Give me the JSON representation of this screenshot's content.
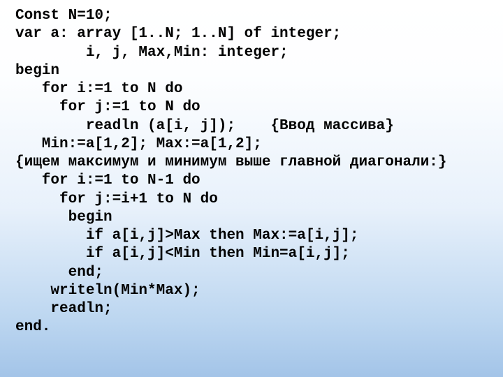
{
  "code": {
    "l01": "Const N=10;",
    "l02": "var a: array [1..N; 1..N] of integer;",
    "l03": "        i, j, Max,Min: integer;",
    "l04": "begin",
    "l05": "   for i:=1 to N do",
    "l06": "     for j:=1 to N do",
    "l07": "        readln (a[i, j]);    {Ввод массива}",
    "l08": "   Min:=a[1,2]; Max:=a[1,2];",
    "l09": "{ищем максимум и минимум выше главной диагонали:}",
    "l10": "   for i:=1 to N-1 do",
    "l11": "     for j:=i+1 to N do",
    "l12": "      begin",
    "l13": "        if a[i,j]>Max then Max:=a[i,j];",
    "l14": "        if a[i,j]<Min then Min=a[i,j];",
    "l15": "      end;",
    "l16": "    writeln(Min*Max);",
    "l17": "    readln;",
    "l18": "end."
  }
}
